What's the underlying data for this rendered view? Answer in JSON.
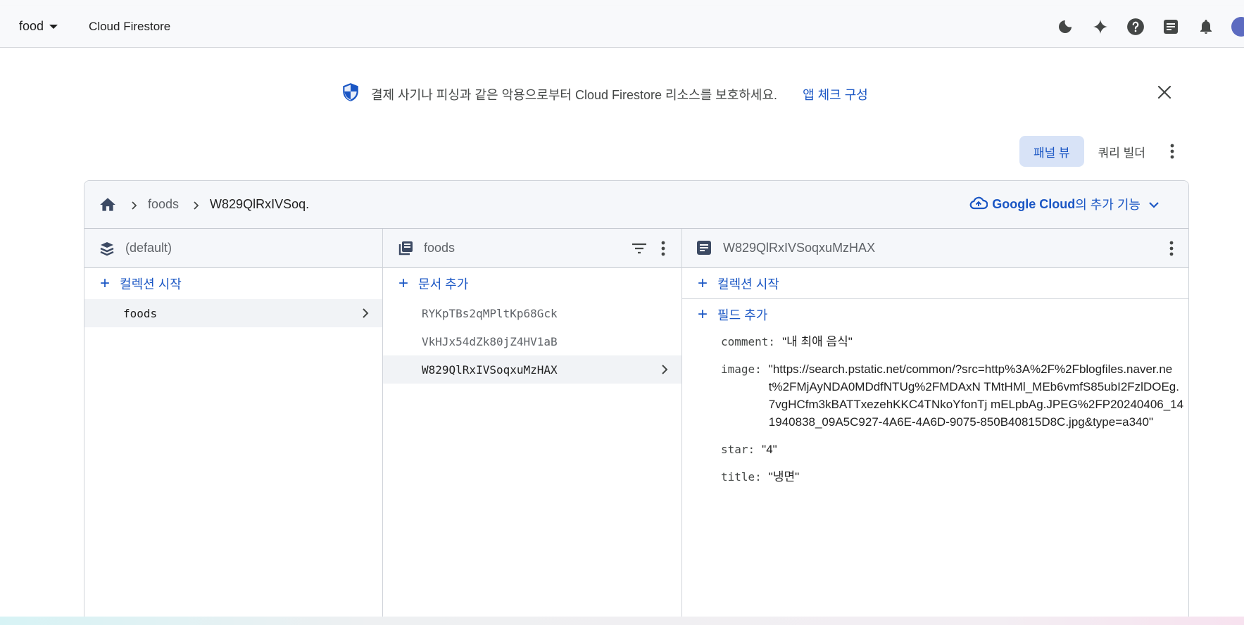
{
  "topbar": {
    "project": "food",
    "product": "Cloud Firestore",
    "icons": [
      "dark-mode-icon",
      "gemini-sparkle-icon",
      "help-icon",
      "release-notes-icon",
      "notifications-icon",
      "avatar"
    ]
  },
  "banner": {
    "message": "결제 사기나 피싱과 같은 악용으로부터 Cloud Firestore 리소스를 보호하세요.",
    "link": "앱 체크 구성"
  },
  "view_tabs": {
    "panel_view": "패널 뷰",
    "query_builder": "쿼리 빌더"
  },
  "breadcrumb": {
    "items": [
      "foods",
      "W829QlRxIVSoq."
    ],
    "gcloud_brand": "Google Cloud",
    "gcloud_suffix": "의 추가 기능"
  },
  "columns": {
    "database": {
      "title": "(default)",
      "add_label": "컬렉션 시작",
      "items": [
        "foods"
      ]
    },
    "collection": {
      "title": "foods",
      "add_label": "문서 추가",
      "items": [
        "RYKpTBs2qMPltKp68Gck",
        "VkHJx54dZk80jZ4HV1aB",
        "W829QlRxIVSoqxuMzHAX"
      ]
    },
    "document": {
      "title": "W829QlRxIVSoqxuMzHAX",
      "add_collection_label": "컬렉션 시작",
      "add_field_label": "필드 추가",
      "fields": [
        {
          "key": "comment:",
          "value": "\"내 최애 음식\""
        },
        {
          "key": "image:",
          "value": "\"https://search.pstatic.net/common/?src=http%3A%2F%2Fblogfiles.naver.net%2FMjAyNDA0MDdfNTUg%2FMDAxN TMtHMl_MEb6vmfS85ubI2FzlDOEg.7vgHCfm3kBATTxezehKKC4TNkoYfonTj mELpbAg.JPEG%2FP20240406_141940838_09A5C927-4A6E-4A6D-9075-850B40815D8C.jpg&type=a340\""
        },
        {
          "key": "star:",
          "value": "\"4\""
        },
        {
          "key": "title:",
          "value": "\"냉면\""
        }
      ]
    }
  },
  "colors": {
    "accent": "#1a56c4",
    "active_tab_bg": "#d8e3f7",
    "header_bg": "#f5f7fa"
  }
}
